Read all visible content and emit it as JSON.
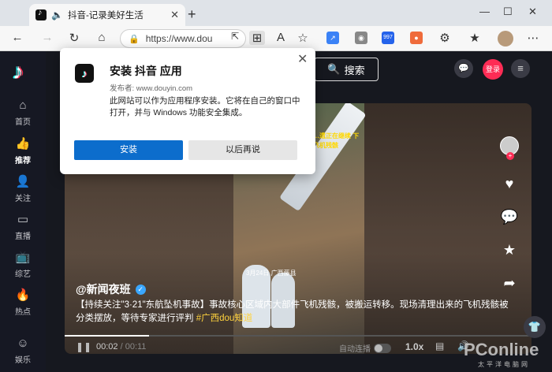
{
  "browser": {
    "tab_title": "抖音-记录美好生活",
    "tab_speaker_icon": "speaker-icon",
    "url": "https://www.dou"
  },
  "extensions": [
    {
      "name": "chart-extension-icon",
      "color": "#3b82f6",
      "label": "↗"
    },
    {
      "name": "user-extension-icon",
      "color": "#888888",
      "label": "◉"
    },
    {
      "name": "badge-extension-icon",
      "color": "#2563eb",
      "label": "997"
    },
    {
      "name": "circle-extension-icon",
      "color": "#ef6b3b",
      "label": "●"
    }
  ],
  "sidebar": {
    "items": [
      {
        "label": "首页",
        "icon": "home-icon"
      },
      {
        "label": "推荐",
        "icon": "thumbs-up-icon"
      },
      {
        "label": "关注",
        "icon": "follow-icon"
      },
      {
        "label": "直播",
        "icon": "live-icon"
      },
      {
        "label": "综艺",
        "icon": "tv-icon"
      },
      {
        "label": "热点",
        "icon": "flame-icon"
      },
      {
        "label": "娱乐",
        "icon": "smile-icon"
      }
    ]
  },
  "header": {
    "search_label": "搜索",
    "login_label": "登录"
  },
  "video": {
    "author": "@新闻夜班",
    "description": "【持续关注\"3·21\"东航坠机事故】事故核心区域内大部件飞机残骸，被搬运转移。现场清理出来的飞机残骸被分类摆放，等待专家进行评判",
    "hashtag": "#广西dou知道",
    "overlay_text": "…遗正在继续 下飞机残骸",
    "frame_caption": "3月24日 广西藤县",
    "current_time": "00:02",
    "duration": "00:11",
    "progress": 0.18,
    "autoplay_label": "自动连播",
    "speed_label": "1.0x"
  },
  "watermark": {
    "brand": "PConline",
    "sub": "太平洋电脑网"
  },
  "dialog": {
    "title": "安装 抖音 应用",
    "publisher": "发布者: www.douyin.com",
    "body": "此网站可以作为应用程序安装。它将在自己的窗口中打开，并与 Windows 功能安全集成。",
    "install_label": "安装",
    "later_label": "以后再说"
  }
}
